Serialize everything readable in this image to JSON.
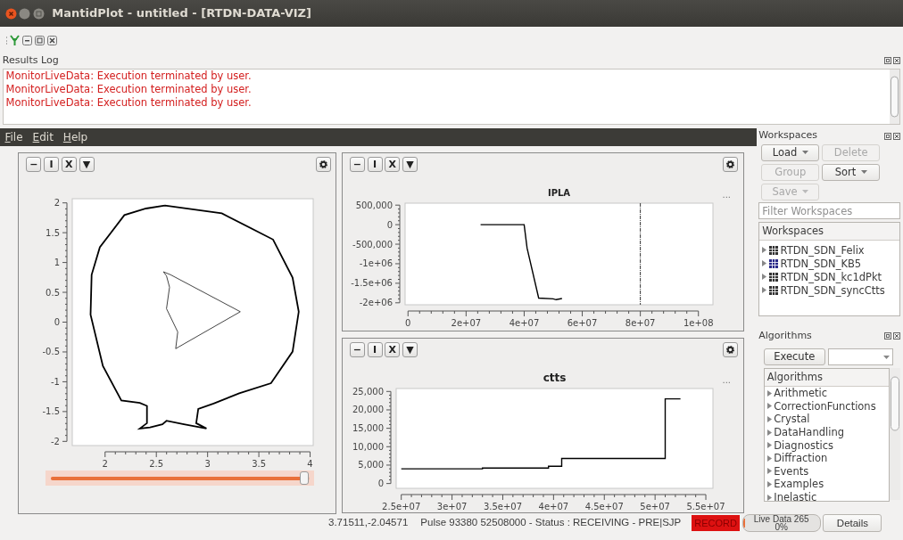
{
  "window": {
    "title": "MantidPlot - untitled - [RTDN-DATA-VIZ]"
  },
  "results_log": {
    "title": "Results Log",
    "lines": [
      "MonitorLiveData: Execution terminated by user.",
      "MonitorLiveData: Execution terminated by user.",
      "MonitorLiveData: Execution terminated by user."
    ]
  },
  "menu": [
    {
      "label": "File"
    },
    {
      "label": "Edit"
    },
    {
      "label": "Help"
    }
  ],
  "plots": [
    {
      "kind": "contour",
      "tools": [
        "−",
        "I",
        "X",
        "▼"
      ],
      "slider": {
        "level": 0.98
      },
      "chart_data": {
        "type": "line",
        "xlim": [
          1.68,
          4.03
        ],
        "ylim": [
          -2.07,
          2.07
        ],
        "xticks": [
          2,
          2.5,
          3,
          3.5,
          4
        ],
        "yticks": [
          2,
          1.5,
          1,
          0.5,
          0,
          -0.5,
          -1,
          -1.5,
          -2
        ]
      }
    },
    {
      "kind": "line",
      "tools": [
        "−",
        "I",
        "X",
        "▼"
      ],
      "more": "...",
      "chart_data": {
        "type": "line",
        "title": "IPLA",
        "xlim": [
          -1000000,
          105000000
        ],
        "ylim": [
          -2050000,
          550000
        ],
        "xticks": [
          {
            "value": 0,
            "label": "0"
          },
          {
            "value": 20000000,
            "label": "2e+07"
          },
          {
            "value": 40000000,
            "label": "4e+07"
          },
          {
            "value": 60000000,
            "label": "6e+07"
          },
          {
            "value": 80000000,
            "label": "8e+07"
          },
          {
            "value": 100000000,
            "label": "1e+08"
          }
        ],
        "yticks": [
          {
            "value": 500000,
            "label": "500,000"
          },
          {
            "value": 0,
            "label": "0"
          },
          {
            "value": -500000,
            "label": "-500,000"
          },
          {
            "value": -1000000,
            "label": "-1e+06"
          },
          {
            "value": -1500000,
            "label": "-1.5e+06"
          },
          {
            "value": -2000000,
            "label": "-2e+06"
          }
        ],
        "x": [
          25000000,
          40000000,
          41000000,
          45000000,
          50000000,
          51000000,
          53000000
        ],
        "series": [
          {
            "color": "#000000",
            "values": [
              0,
              0,
              -600000,
              -1880000,
              -1900000,
              -1920000,
              -1890000
            ]
          }
        ],
        "ref_lines": [
          {
            "axis": "x",
            "value": 80000000
          }
        ]
      }
    },
    {
      "kind": "line",
      "tools": [
        "−",
        "I",
        "X",
        "▼"
      ],
      "more": "...",
      "chart_data": {
        "type": "line",
        "title": "ctts",
        "xlim": [
          24500000,
          55700000
        ],
        "ylim": [
          -1300,
          25800
        ],
        "xticks": [
          {
            "value": 25000000,
            "label": "2.5e+07"
          },
          {
            "value": 30000000,
            "label": "3e+07"
          },
          {
            "value": 35000000,
            "label": "3.5e+07"
          },
          {
            "value": 40000000,
            "label": "4e+07"
          },
          {
            "value": 45000000,
            "label": "4.5e+07"
          },
          {
            "value": 50000000,
            "label": "5e+07"
          },
          {
            "value": 55000000,
            "label": "5.5e+07"
          }
        ],
        "yticks": [
          {
            "value": 25000,
            "label": "25,000"
          },
          {
            "value": 20000,
            "label": "20,000"
          },
          {
            "value": 15000,
            "label": "15,000"
          },
          {
            "value": 10000,
            "label": "10,000"
          },
          {
            "value": 5000,
            "label": "5,000"
          },
          {
            "value": 0,
            "label": "0"
          }
        ],
        "x": [
          25000000,
          33000000,
          33000000,
          39500000,
          39500000,
          40800000,
          40800000,
          51000000,
          51000000,
          52500000
        ],
        "series": [
          {
            "color": "#000000",
            "values": [
              4000,
              4000,
              4200,
              4200,
              4700,
              4700,
              6800,
              6800,
              23000,
              23000
            ]
          }
        ]
      }
    }
  ],
  "workspaces": {
    "title": "Workspaces",
    "buttons": [
      {
        "label": "Load",
        "dropdown": true,
        "disabled": false
      },
      {
        "label": "Delete",
        "dropdown": false,
        "disabled": true
      },
      {
        "label": "Group",
        "dropdown": false,
        "disabled": true
      },
      {
        "label": "Sort",
        "dropdown": true,
        "disabled": false
      },
      {
        "label": "Save",
        "dropdown": true,
        "disabled": true
      }
    ],
    "filter": {
      "placeholder": "Filter Workspaces"
    },
    "header": "Workspaces",
    "items": [
      {
        "name": "RTDN_SDN_Felix",
        "color": "#333333"
      },
      {
        "name": "RTDN_SDN_KB5",
        "color": "#2a2a8a"
      },
      {
        "name": "RTDN_SDN_kc1dPkt",
        "color": "#333333"
      },
      {
        "name": "RTDN_SDN_syncCtts",
        "color": "#333333"
      }
    ]
  },
  "algorithms": {
    "title": "Algorithms",
    "execute": "Execute",
    "header": "Algorithms",
    "items": [
      "Arithmetic",
      "CorrectionFunctions",
      "Crystal",
      "DataHandling",
      "Diagnostics",
      "Diffraction",
      "Events",
      "Examples",
      "Inelastic"
    ]
  },
  "status_bar": {
    "coordinates": "3.71511,-2.04571",
    "status": "Pulse 93380 52508000 - Status : RECEIVING - PRE|SJP",
    "record": "RECORD",
    "live_data": {
      "label": "Live Data 265",
      "percent": "0%",
      "level": 0.03
    },
    "details": "Details"
  }
}
